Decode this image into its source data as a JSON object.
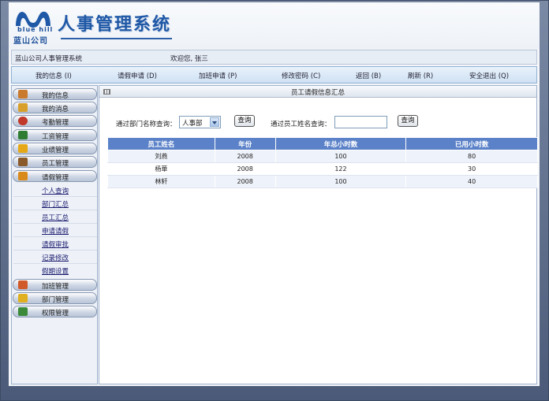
{
  "header": {
    "logo_en": "blue hill",
    "logo_cn": "蓝山公司",
    "system_title": "人事管理系统"
  },
  "infobar": {
    "app_name": "蓝山公司人事管理系统",
    "welcome": "欢迎您, 张三"
  },
  "nav": {
    "items": [
      {
        "label": "我的信息 (I)"
      },
      {
        "label": "请假申请 (D)"
      },
      {
        "label": "加班申请 (P)"
      },
      {
        "label": "修改密码 (C)"
      },
      {
        "label": "返回 (B)"
      },
      {
        "label": "刷新 (R)"
      },
      {
        "label": "安全退出 (Q)"
      }
    ]
  },
  "sidebar": {
    "groups_top": [
      {
        "label": "我的信息",
        "icon": "user-info-icon",
        "color": "#c97a2c"
      },
      {
        "label": "我的消息",
        "icon": "message-icon",
        "color": "#d8a02a"
      },
      {
        "label": "考勤管理",
        "icon": "clock-icon",
        "color": "#c0392b"
      },
      {
        "label": "工资管理",
        "icon": "money-icon",
        "color": "#2e7d32"
      },
      {
        "label": "业绩管理",
        "icon": "chart-icon",
        "color": "#e6a817"
      },
      {
        "label": "员工管理",
        "icon": "people-icon",
        "color": "#8a5a2b"
      },
      {
        "label": "请假管理",
        "icon": "document-icon",
        "color": "#d88a1a"
      }
    ],
    "sub_items": [
      {
        "label": "个人查询"
      },
      {
        "label": "部门汇总"
      },
      {
        "label": "员工汇总"
      },
      {
        "label": "申请请假"
      },
      {
        "label": "请假审批"
      },
      {
        "label": "记录修改"
      },
      {
        "label": "假期设置"
      }
    ],
    "groups_bottom": [
      {
        "label": "加班管理",
        "icon": "pencil-icon",
        "color": "#d05a2a"
      },
      {
        "label": "部门管理",
        "icon": "folder-icon",
        "color": "#e0b020"
      },
      {
        "label": "权限管理",
        "icon": "key-icon",
        "color": "#3a8a3a"
      }
    ]
  },
  "main": {
    "title": "员工请假信息汇总",
    "dept_query_label": "通过部门名称查询：",
    "dept_selected": "人事部",
    "query_button": "查询",
    "name_query_label": "通过员工姓名查询：",
    "name_input_value": "",
    "table": {
      "headers": [
        "员工姓名",
        "年份",
        "年总小时数",
        "已用小时数"
      ],
      "rows": [
        [
          "刘燕",
          "2008",
          "100",
          "80"
        ],
        [
          "杨華",
          "2008",
          "122",
          "30"
        ],
        [
          "林轩",
          "2008",
          "100",
          "40"
        ]
      ]
    }
  }
}
